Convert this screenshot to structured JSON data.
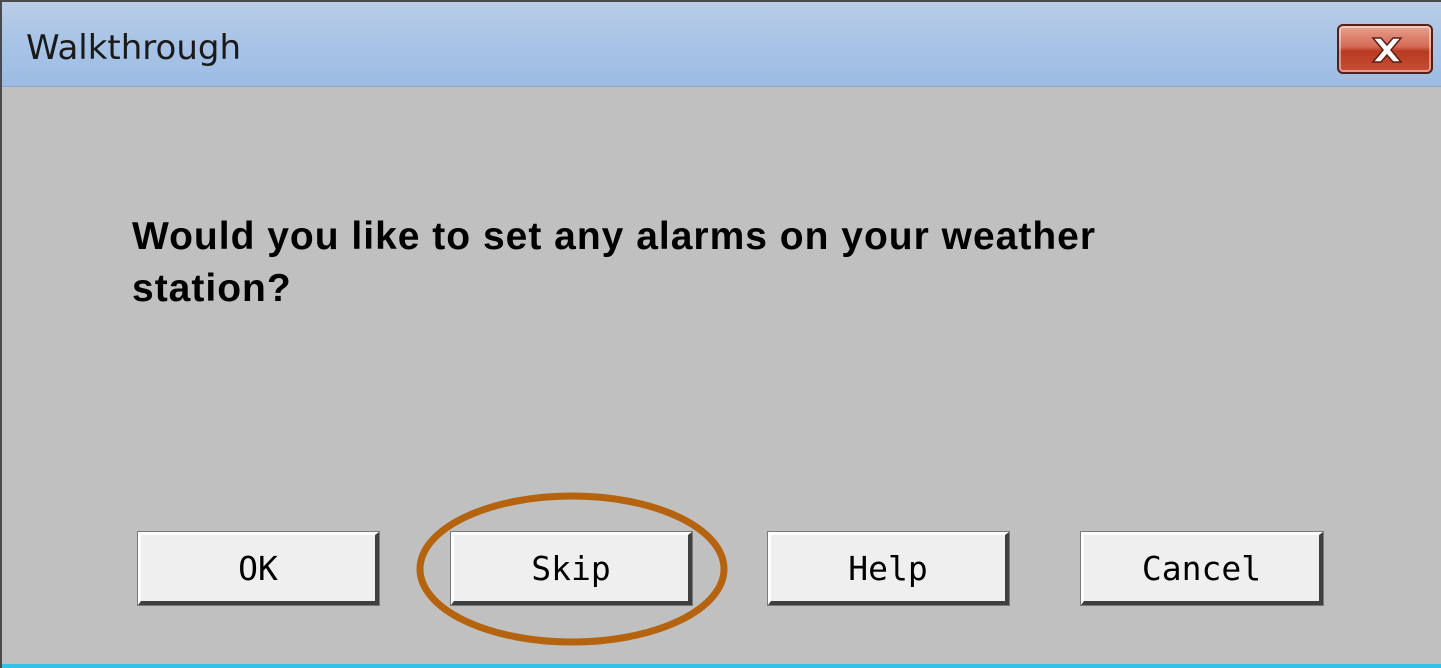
{
  "window": {
    "title": "Walkthrough",
    "close_icon": "close-x-icon"
  },
  "dialog": {
    "question": "Would you like to set any alarms on your weather station?"
  },
  "buttons": {
    "ok": "OK",
    "skip": "Skip",
    "help": "Help",
    "cancel": "Cancel"
  },
  "colors": {
    "titlebar": "#a9c4e6",
    "body": "#c0c0c0",
    "close_button": "#c74f35",
    "highlight_ring": "#b5630e",
    "bottom_strip": "#33c2e6"
  },
  "annotation": {
    "highlighted_control": "Skip"
  }
}
